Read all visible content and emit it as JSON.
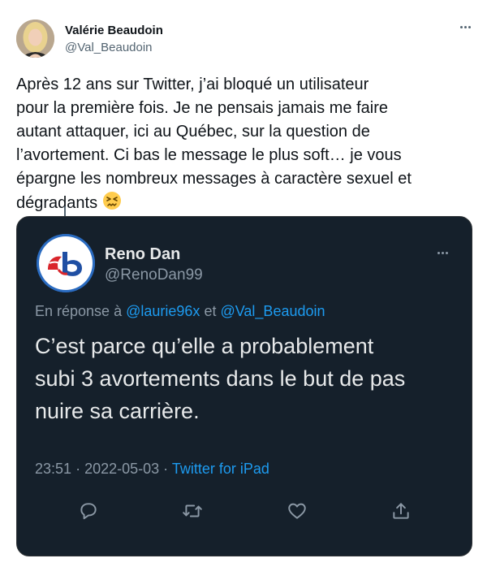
{
  "tweet": {
    "author_name": "Valérie Beaudoin",
    "author_handle": "@Val_Beaudoin",
    "text": "Après 12 ans sur Twitter, j’ai bloqué un utilisateur\npour la première fois. Je ne pensais jamais me faire\nautant attaquer, ici au Québec, sur la question de\nl’avortement. Ci bas le message le plus soft… je vous\népargne les nombreux messages à caractère sexuel et\ndégradants",
    "emoji": "persevering-face-emoji",
    "more_icon": "more-horizontal-icon"
  },
  "quoted": {
    "author_name": "Reno Dan",
    "author_handle": "@RenoDan99",
    "reply_prefix": "En réponse à",
    "mention_1": "@laurie96x",
    "reply_joiner": "et",
    "mention_2": "@Val_Beaudoin",
    "text": "C’est parce qu’elle a probablement\nsubi 3 avortements dans le but de pas\nnuire sa carrière.",
    "time": "23:51",
    "sep_1": "·",
    "date": "2022-05-03",
    "sep_2": "·",
    "source": "Twitter for iPad",
    "colors": {
      "background": "#15202b",
      "link": "#1d9bf0",
      "muted": "#8b98a5"
    },
    "actions": [
      "reply-icon",
      "retweet-icon",
      "like-icon",
      "share-icon"
    ]
  }
}
